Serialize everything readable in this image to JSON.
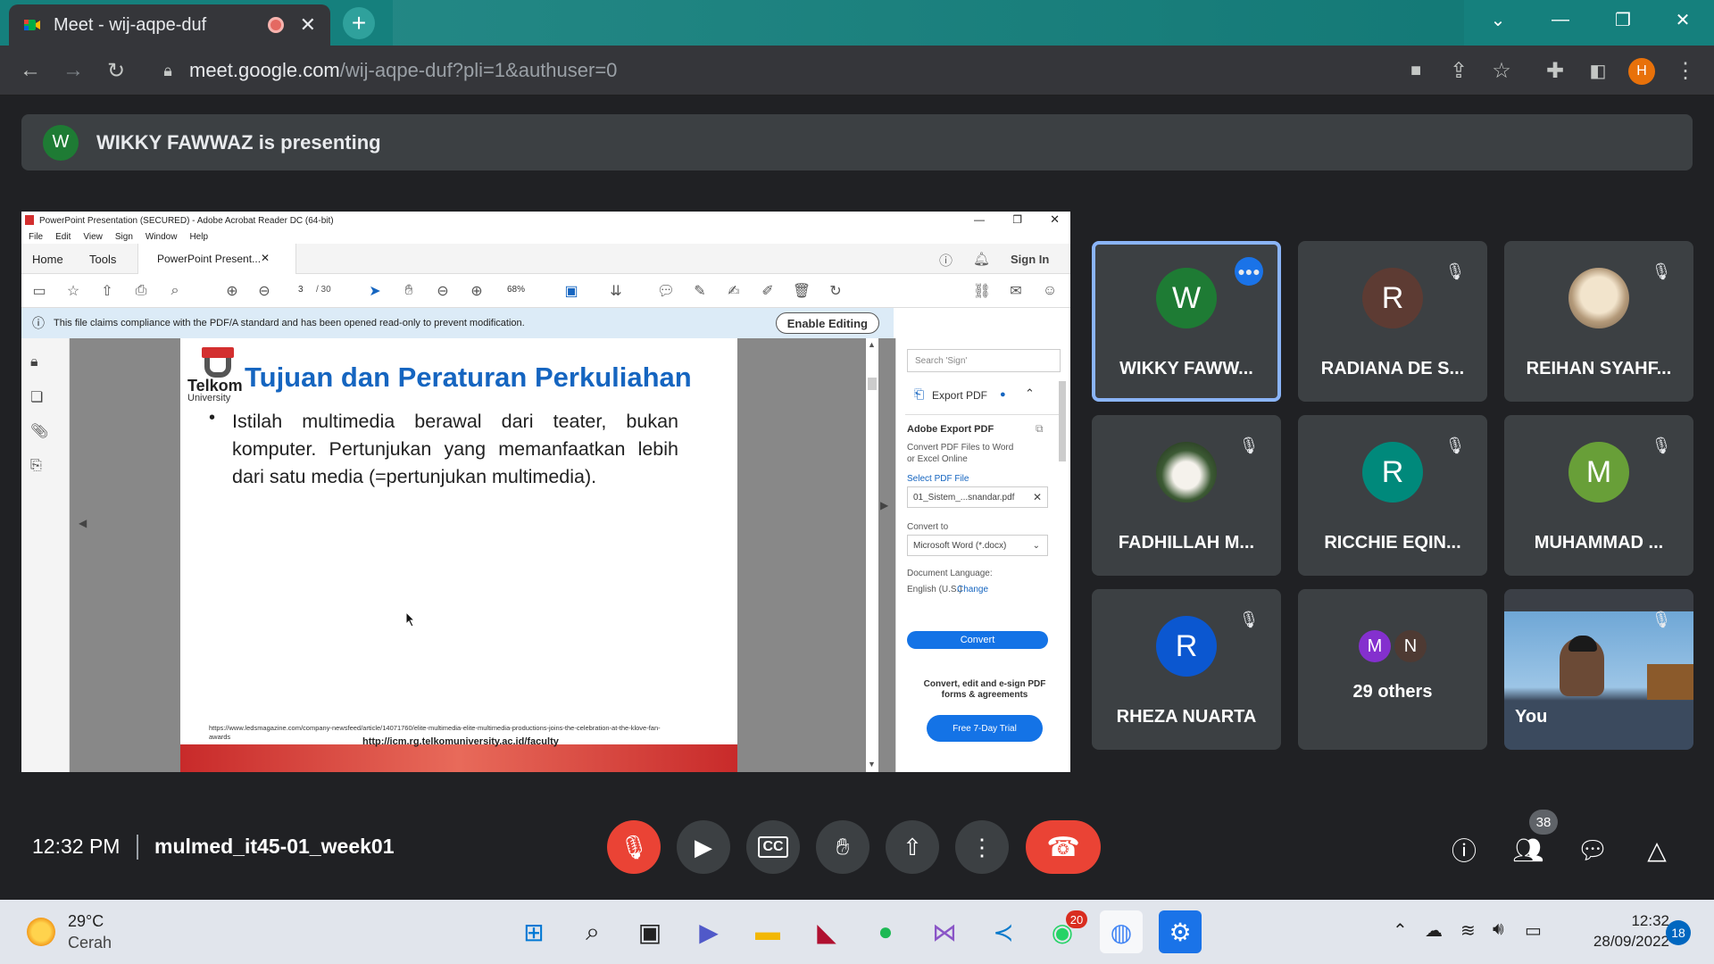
{
  "window": {
    "tab_title": "Meet - wij-aqpe-duf",
    "url_host": "meet.google.com",
    "url_path": "/wij-aqpe-duf?pli=1&authuser=0",
    "profile_initial": "H"
  },
  "presenting": {
    "initial": "W",
    "text": "WIKKY FAWWAZ is presenting"
  },
  "acrobat": {
    "title": "PowerPoint Presentation (SECURED) - Adobe Acrobat Reader DC (64-bit)",
    "menu": [
      "File",
      "Edit",
      "View",
      "Sign",
      "Window",
      "Help"
    ],
    "tab_home": "Home",
    "tab_tools": "Tools",
    "tab_doc": "PowerPoint Present...",
    "sign_in": "Sign In",
    "page_current": "3",
    "page_total": "/ 30",
    "zoom": "68%",
    "info": "This file claims compliance with the PDF/A standard and has been opened read-only to prevent modification.",
    "enable_editing": "Enable Editing",
    "slide_title": "Tujuan dan Peraturan Perkuliahan",
    "slide_body": "Istilah multimedia berawal dari teater, bukan komputer. Pertunjukan yang memanfaatkan lebih dari satu media (=pertunjukan multimedia).",
    "logo_name": "Telkom",
    "logo_sub": "University",
    "footer_ref": "https://www.ledsmagazine.com/company-newsfeed/article/14071760/elite-multimedia-elite-multimedia-productions-joins-the-celebration-at-the-klove-fan-awards",
    "footer_url": "http://icm.rg.telkomuniversity.ac.id/faculty",
    "panel": {
      "search_placeholder": "Search 'Sign'",
      "export_label": "Export PDF",
      "export_title": "Adobe Export PDF",
      "export_desc": "Convert PDF Files to Word or Excel Online",
      "select_file": "Select PDF File",
      "file_name": "01_Sistem_...snandar.pdf",
      "convert_to": "Convert to",
      "format": "Microsoft Word (*.docx)",
      "doc_lang": "Document Language:",
      "lang": "English (U.S.)",
      "change": "Change",
      "convert_btn": "Convert",
      "promo": "Convert, edit and e-sign PDF forms & agreements",
      "trial_btn": "Free 7-Day Trial"
    }
  },
  "participants": [
    {
      "name": "WIKKY FAWW...",
      "initial": "W",
      "color": "#1e7b34",
      "status": "speaking"
    },
    {
      "name": "RADIANA DE S...",
      "initial": "R",
      "color": "#5d3b33",
      "status": "muted"
    },
    {
      "name": "REIHAN SYAHF...",
      "initial": "",
      "color": "#a08870",
      "status": "muted"
    },
    {
      "name": "FADHILLAH M...",
      "initial": "",
      "color": "#556b4a",
      "status": "muted"
    },
    {
      "name": "RICCHIE EQIN...",
      "initial": "R",
      "color": "#00897b",
      "status": "muted"
    },
    {
      "name": "MUHAMMAD ...",
      "initial": "M",
      "color": "#689f38",
      "status": "muted"
    },
    {
      "name": "RHEZA NUARTA",
      "initial": "R",
      "color": "#0b57d0",
      "status": "muted"
    }
  ],
  "others": {
    "label": "29 others",
    "a": "M",
    "b": "N"
  },
  "self_label": "You",
  "meeting": {
    "time": "12:32 PM",
    "code": "mulmed_it45-01_week01",
    "people_count": "38"
  },
  "taskbar": {
    "weather_temp": "29°C",
    "weather_desc": "Cerah",
    "clock": "12:32",
    "date": "28/09/2022",
    "whatsapp_badge": "20",
    "notif_count": "18"
  }
}
